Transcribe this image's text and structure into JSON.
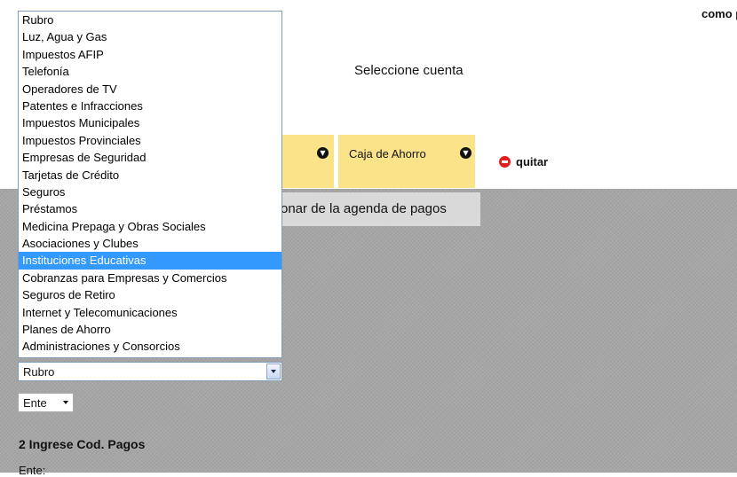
{
  "header": {
    "top_right_text": "como p"
  },
  "account": {
    "label": "Seleccione cuenta",
    "selected_account": "Caja de Ahorro"
  },
  "actions": {
    "remove_label": "quitar",
    "agenda_button": "onar de la agenda de pagos"
  },
  "rubro": {
    "selected": "Rubro",
    "options": [
      "Rubro",
      "Luz, Agua y Gas",
      "Impuestos AFIP",
      "Telefonía",
      "Operadores de TV",
      "Patentes e Infracciones",
      "Impuestos Municipales",
      "Impuestos Provinciales",
      "Empresas de Seguridad",
      "Tarjetas de Crédito",
      "Seguros",
      "Préstamos",
      "Medicina Prepaga y Obras Sociales",
      "Asociaciones y Clubes",
      "Instituciones Educativas",
      "Cobranzas para Empresas y Comercios",
      "Seguros de Retiro",
      "Internet y Telecomunicaciones",
      "Planes de Ahorro",
      "Administraciones y Consorcios"
    ],
    "highlighted_option": "Instituciones Educativas"
  },
  "ente": {
    "selected": "Ente"
  },
  "section2": {
    "title": "2 Ingrese Cod. Pagos",
    "ente_label": "Ente:"
  },
  "colors": {
    "highlight": "#3399ff",
    "yellow": "#fbe38a",
    "remove": "#e02020",
    "gray_bg": "#a6a6a6"
  }
}
